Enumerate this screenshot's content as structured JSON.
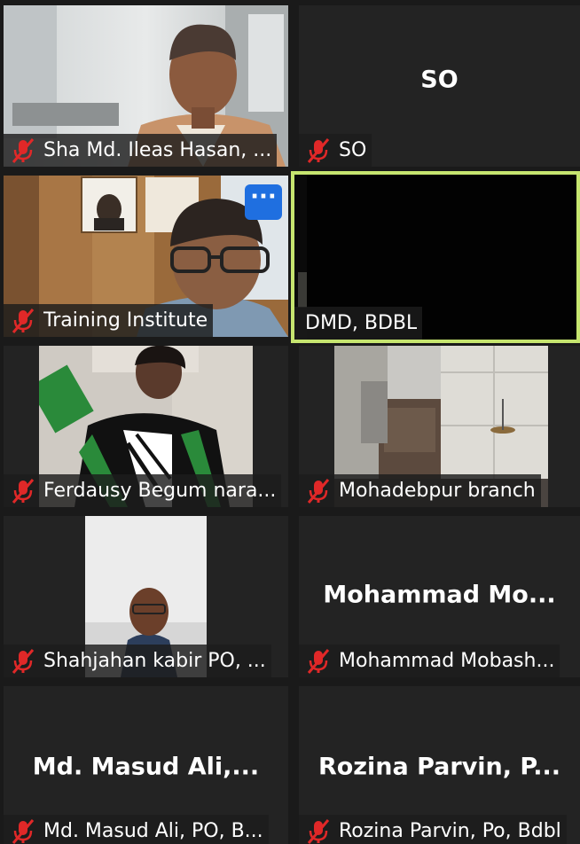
{
  "tiles": [
    {
      "label": "Sha Md. Ileas Hasan, ...",
      "big_name": ""
    },
    {
      "label": "SO",
      "big_name": "SO"
    },
    {
      "label": "Training Institute",
      "big_name": "",
      "more_button": "···"
    },
    {
      "label": "DMD, BDBL",
      "big_name": ""
    },
    {
      "label": "Ferdausy Begum nara...",
      "big_name": ""
    },
    {
      "label": "Mohadebpur branch",
      "big_name": ""
    },
    {
      "label": "Shahjahan kabir PO, ...",
      "big_name": ""
    },
    {
      "label": "Mohammad Mobash...",
      "big_name": "Mohammad  Mo..."
    },
    {
      "label": "Md. Masud Ali, PO, B...",
      "big_name": "Md.  Masud  Ali,..."
    },
    {
      "label": "Rozina Parvin, Po, Bdbl",
      "big_name": "Rozina  Parvin,  P..."
    }
  ],
  "icons": {
    "mic_muted": "muted-mic-icon",
    "more": "more-options-icon"
  },
  "colors": {
    "background": "#1a1a1a",
    "tile": "#232323",
    "active_speaker_border": "#c6e56f",
    "muted_mic": "#e02828",
    "more_button": "#1f6fe0"
  }
}
